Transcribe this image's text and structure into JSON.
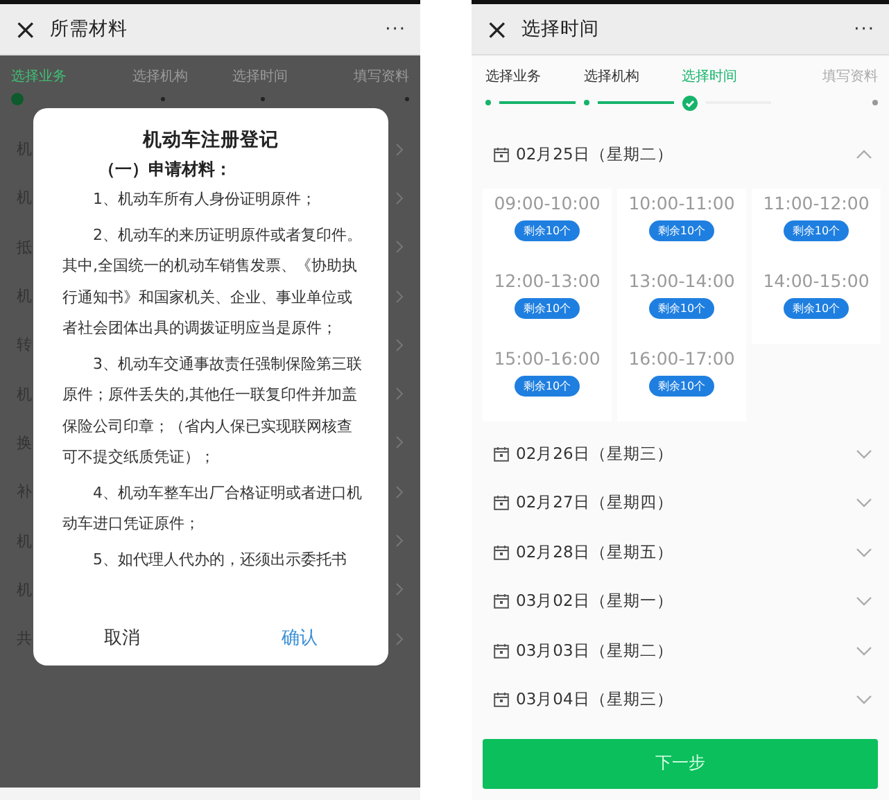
{
  "left": {
    "header": {
      "title": "所需材料",
      "close": "×",
      "more": "···"
    },
    "steps": [
      {
        "label": "选择业务",
        "selected": true
      },
      {
        "label": "选择机构",
        "selected": false
      },
      {
        "label": "选择时间",
        "selected": false
      },
      {
        "label": "填写资料",
        "selected": false
      }
    ],
    "list_items": [
      {
        "text": "机"
      },
      {
        "text": "机"
      },
      {
        "text": "抵"
      },
      {
        "text": "机"
      },
      {
        "text": "转"
      },
      {
        "text": "机"
      },
      {
        "text": "换"
      },
      {
        "text": "补"
      },
      {
        "text": "机"
      },
      {
        "text": "机"
      },
      {
        "text": "共"
      }
    ],
    "dialog": {
      "title": "机动车注册登记",
      "subtitle": "（一）申请材料：",
      "paragraphs": [
        "1、机动车所有人身份证明原件；",
        "2、机动车的来历证明原件或者复印件。其中,全国统一的机动车销售发票、《协助执行通知书》和国家机关、企业、事业单位或者社会团体出具的调拨证明应当是原件；",
        "3、机动车交通事故责任强制保险第三联原件；原件丢失的,其他任一联复印件并加盖保险公司印章；（省内人保已实现联网核查可不提交纸质凭证）；",
        "4、机动车整车出厂合格证明或者进口机动车进口凭证原件；",
        "5、如代理人代办的，还须出示委托书"
      ],
      "buttons": [
        {
          "label": "取消",
          "kind": "cancel"
        },
        {
          "label": "确认",
          "kind": "confirm"
        }
      ]
    }
  },
  "right": {
    "header": {
      "title": "选择时间",
      "close": "×",
      "more": "···"
    },
    "steps": [
      {
        "label": "选择业务",
        "selected": false
      },
      {
        "label": "选择机构",
        "selected": false
      },
      {
        "label": "选择时间",
        "selected": true
      },
      {
        "label": "填写资料",
        "selected": false
      }
    ],
    "dates": [
      {
        "label": "02月25日（星期二）",
        "expanded": true,
        "slots": [
          {
            "time": "09:00-10:00",
            "badge": "剩余10个"
          },
          {
            "time": "10:00-11:00",
            "badge": "剩余10个"
          },
          {
            "time": "11:00-12:00",
            "badge": "剩余10个"
          },
          {
            "time": "12:00-13:00",
            "badge": "剩余10个"
          },
          {
            "time": "13:00-14:00",
            "badge": "剩余10个"
          },
          {
            "time": "14:00-15:00",
            "badge": "剩余10个"
          },
          {
            "time": "15:00-16:00",
            "badge": "剩余10个"
          },
          {
            "time": "16:00-17:00",
            "badge": "剩余10个"
          }
        ]
      },
      {
        "label": "02月26日（星期三）",
        "expanded": false
      },
      {
        "label": "02月27日（星期四）",
        "expanded": false
      },
      {
        "label": "02月28日（星期五）",
        "expanded": false
      },
      {
        "label": "03月02日（星期一）",
        "expanded": false
      },
      {
        "label": "03月03日（星期二）",
        "expanded": false
      },
      {
        "label": "03月04日（星期三）",
        "expanded": false
      }
    ],
    "next_button": "下一步"
  }
}
